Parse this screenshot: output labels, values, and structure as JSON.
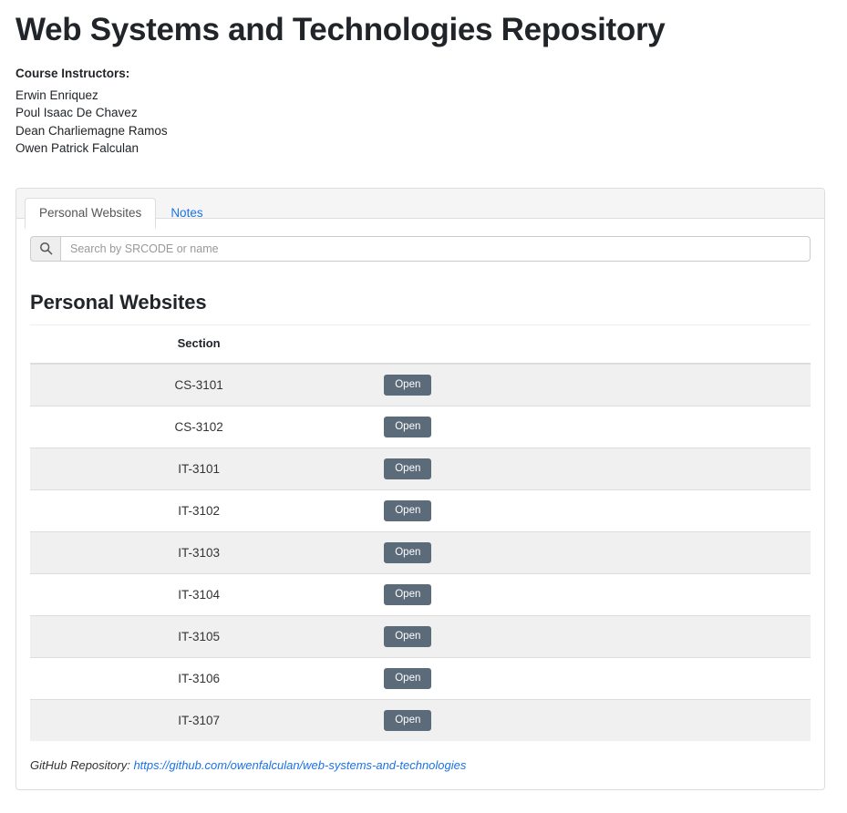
{
  "header": {
    "title": "Web Systems and Technologies Repository",
    "instructors_label": "Course Instructors:",
    "instructors": [
      "Erwin Enriquez",
      "Poul Isaac De Chavez",
      "Dean Charliemagne Ramos",
      "Owen Patrick Falculan"
    ]
  },
  "tabs": [
    {
      "label": "Personal Websites",
      "active": true
    },
    {
      "label": "Notes",
      "active": false
    }
  ],
  "search": {
    "icon": "search-icon",
    "value": "",
    "placeholder": "Search by SRCODE or name"
  },
  "section": {
    "heading": "Personal Websites",
    "columns": [
      "Section",
      ""
    ],
    "rows": [
      {
        "section": "CS-3101",
        "action": "Open"
      },
      {
        "section": "CS-3102",
        "action": "Open"
      },
      {
        "section": "IT-3101",
        "action": "Open"
      },
      {
        "section": "IT-3102",
        "action": "Open"
      },
      {
        "section": "IT-3103",
        "action": "Open"
      },
      {
        "section": "IT-3104",
        "action": "Open"
      },
      {
        "section": "IT-3105",
        "action": "Open"
      },
      {
        "section": "IT-3106",
        "action": "Open"
      },
      {
        "section": "IT-3107",
        "action": "Open"
      }
    ]
  },
  "footer": {
    "label": "GitHub Repository:",
    "link_text": "https://github.com/owenfalculan/web-systems-and-technologies"
  },
  "colors": {
    "link": "#1a73e8",
    "button": "#5c6b7a",
    "panel_border": "#dddddd",
    "stripe": "#f0f0f0",
    "tab_bar": "#f5f5f5"
  }
}
